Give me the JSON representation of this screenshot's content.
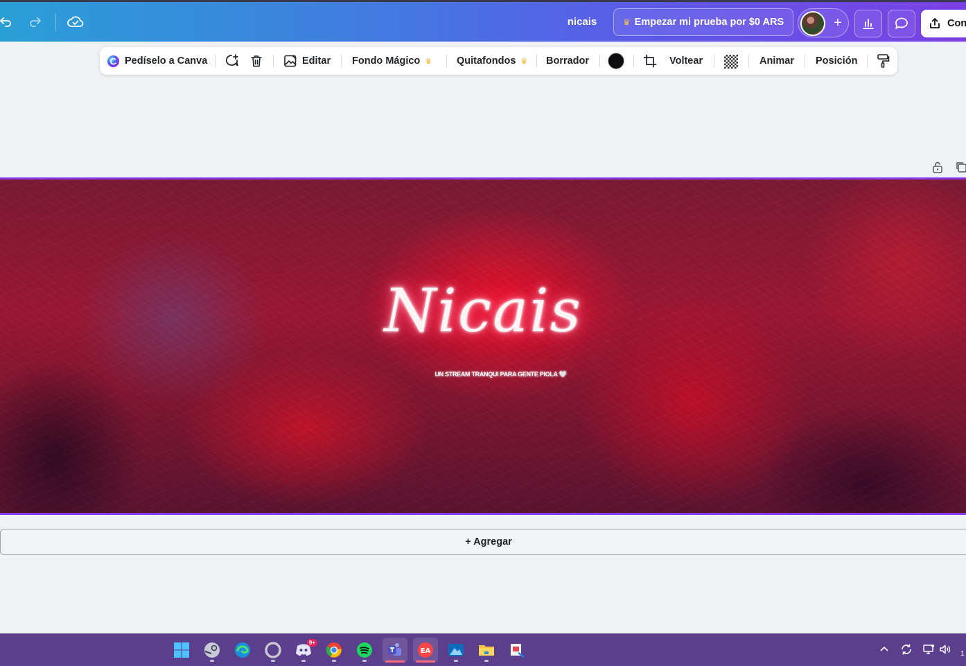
{
  "header": {
    "doc_title": "nicais",
    "trial_button": "Empezar mi prueba por $0 ARS",
    "share_button": "Con",
    "icons": [
      "undo-icon",
      "redo-icon",
      "cloud-saved-icon",
      "crown-icon",
      "add-collaborator-icon",
      "insights-icon",
      "comments-icon",
      "share-icon"
    ]
  },
  "toolbar": {
    "ask_canva": "Pedíselo a Canva",
    "edit": "Editar",
    "magic_bg": "Fondo Mágico",
    "remove_bg": "Quitafondos",
    "eraser": "Borrador",
    "flip": "Voltear",
    "animate": "Animar",
    "position": "Posición",
    "color_swatch": "#0e0e10"
  },
  "canvas": {
    "title_text": "Nicais",
    "tagline": "UN STREAM TRANQUI PARA GENTE PIOLA 🤍",
    "accent_border": "#8b3dff"
  },
  "add_page": {
    "label": "+ Agregar"
  },
  "taskbar": {
    "notification_badge": "9+",
    "apps": [
      "windows-start",
      "steam",
      "edge",
      "opera-gx",
      "discord",
      "chrome",
      "spotify",
      "teams",
      "ea-app",
      "photos",
      "file-explorer",
      "snipping-tool"
    ],
    "clock_fragment": "1"
  }
}
